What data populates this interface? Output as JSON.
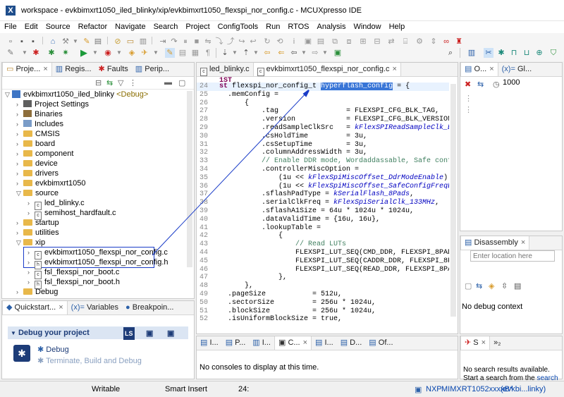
{
  "window": {
    "title": "workspace - evkbimxrt1050_iled_blinky/xip/evkbimxrt1050_flexspi_nor_config.c - MCUXpresso IDE"
  },
  "menu": [
    "File",
    "Edit",
    "Source",
    "Refactor",
    "Navigate",
    "Search",
    "Project",
    "ConfigTools",
    "Run",
    "RTOS",
    "Analysis",
    "Window",
    "Help"
  ],
  "left_tabs": [
    "Proje...",
    "Regis...",
    "Faults",
    "Perip..."
  ],
  "tree": {
    "root_label": "evkbimxrt1050_iled_blinky",
    "root_badge": "<Debug>",
    "items": [
      "Project Settings",
      "Binaries",
      "Includes",
      "CMSIS",
      "board",
      "component",
      "device",
      "drivers",
      "evkbimxrt1050",
      "source",
      "led_blinky.c",
      "semihost_hardfault.c",
      "startup",
      "utilities",
      "xip",
      "evkbimxrt1050_flexspi_nor_config.c",
      "evkbimxrt1050_flexspi_nor_config.h",
      "fsl_flexspi_nor_boot.c",
      "fsl_flexspi_nor_boot.h",
      "Debug"
    ]
  },
  "quickstart": {
    "tabs": [
      "Quickstart...",
      "Variables",
      "Breakpoin..."
    ],
    "header": "Debug your project",
    "debug": "Debug",
    "terminate": "Terminate, Build and Debug"
  },
  "editor": {
    "tabs": [
      "led_blinky.c",
      "evkbimxrt1050_flexspi_nor_config.c"
    ],
    "lines": [
      {
        "n": "",
        "t": "1ST"
      },
      {
        "n": "24",
        "t": "st flexspi_nor_config_t hyperflash_config = {"
      },
      {
        "n": "25",
        "t": "  .memConfig ="
      },
      {
        "n": "26",
        "t": "      {"
      },
      {
        "n": "27",
        "t": "          .tag                = FLEXSPI_CFG_BLK_TAG,"
      },
      {
        "n": "28",
        "t": "          .version            = FLEXSPI_CFG_BLK_VERSION,"
      },
      {
        "n": "29",
        "t": "          .readSampleClkSrc   = kFlexSPIReadSampleClk_Exter"
      },
      {
        "n": "30",
        "t": "          .csHoldTime         = 3u,"
      },
      {
        "n": "31",
        "t": "          .csSetupTime        = 3u,"
      },
      {
        "n": "32",
        "t": "          .columnAddressWidth = 3u,"
      },
      {
        "n": "33",
        "t": "          // Enable DDR mode, Wordaddassable, Safe configur"
      },
      {
        "n": "34",
        "t": "          .controllerMiscOption ="
      },
      {
        "n": "35",
        "t": "              (1u << kFlexSpiMiscOffset_DdrModeEnable) | (1"
      },
      {
        "n": "36",
        "t": "              (1u << kFlexSpiMiscOffset_SafeConfigFreqEnabl"
      },
      {
        "n": "37",
        "t": "          .sflashPadType = kSerialFlash_8Pads,"
      },
      {
        "n": "38",
        "t": "          .serialClkFreq = kFlexSpiSerialClk_133MHz,"
      },
      {
        "n": "39",
        "t": "          .sflashA1Size = 64u * 1024u * 1024u,"
      },
      {
        "n": "40",
        "t": "          .dataValidTime = {16u, 16u},"
      },
      {
        "n": "41",
        "t": "          .lookupTable ="
      },
      {
        "n": "42",
        "t": "              {"
      },
      {
        "n": "43",
        "t": "                  // Read LUTs"
      },
      {
        "n": "44",
        "t": "                  FLEXSPI_LUT_SEQ(CMD_DDR, FLEXSPI_8PAD, 0x"
      },
      {
        "n": "45",
        "t": "                  FLEXSPI_LUT_SEQ(CADDR_DDR, FLEXSPI_8PAD,"
      },
      {
        "n": "46",
        "t": "                  FLEXSPI_LUT_SEQ(READ_DDR, FLEXSPI_8PAD, 0"
      },
      {
        "n": "47",
        "t": "              },"
      },
      {
        "n": "48",
        "t": "      },"
      },
      {
        "n": "49",
        "t": "  .pageSize           = 512u,"
      },
      {
        "n": "50",
        "t": "  .sectorSize         = 256u * 1024u,"
      },
      {
        "n": "51",
        "t": "  .blockSize          = 256u * 1024u,"
      },
      {
        "n": "52",
        "t": "  .isUniformBlockSize = true,"
      }
    ]
  },
  "console": {
    "tabs": [
      "I...",
      "P...",
      "I...",
      "C...",
      "I...",
      "D...",
      "Of..."
    ],
    "message": "No consoles to display at this time."
  },
  "right_top": {
    "tabs": [
      "O...",
      "Gl..."
    ],
    "value": "1000"
  },
  "disassembly": {
    "tab": "Disassembly",
    "placeholder": "Enter location here",
    "status": "No debug context"
  },
  "search_view": {
    "tab": "S",
    "line1": "No search results available.",
    "line2": "Start a search from the ",
    "link": "search"
  },
  "status": {
    "mode": "Writable",
    "insert": "Smart Insert",
    "pos": "24:",
    "nxp": "NXP",
    "device": "MIMXRT1052xxxxB*",
    "proj": "(evkbi...linky)"
  }
}
